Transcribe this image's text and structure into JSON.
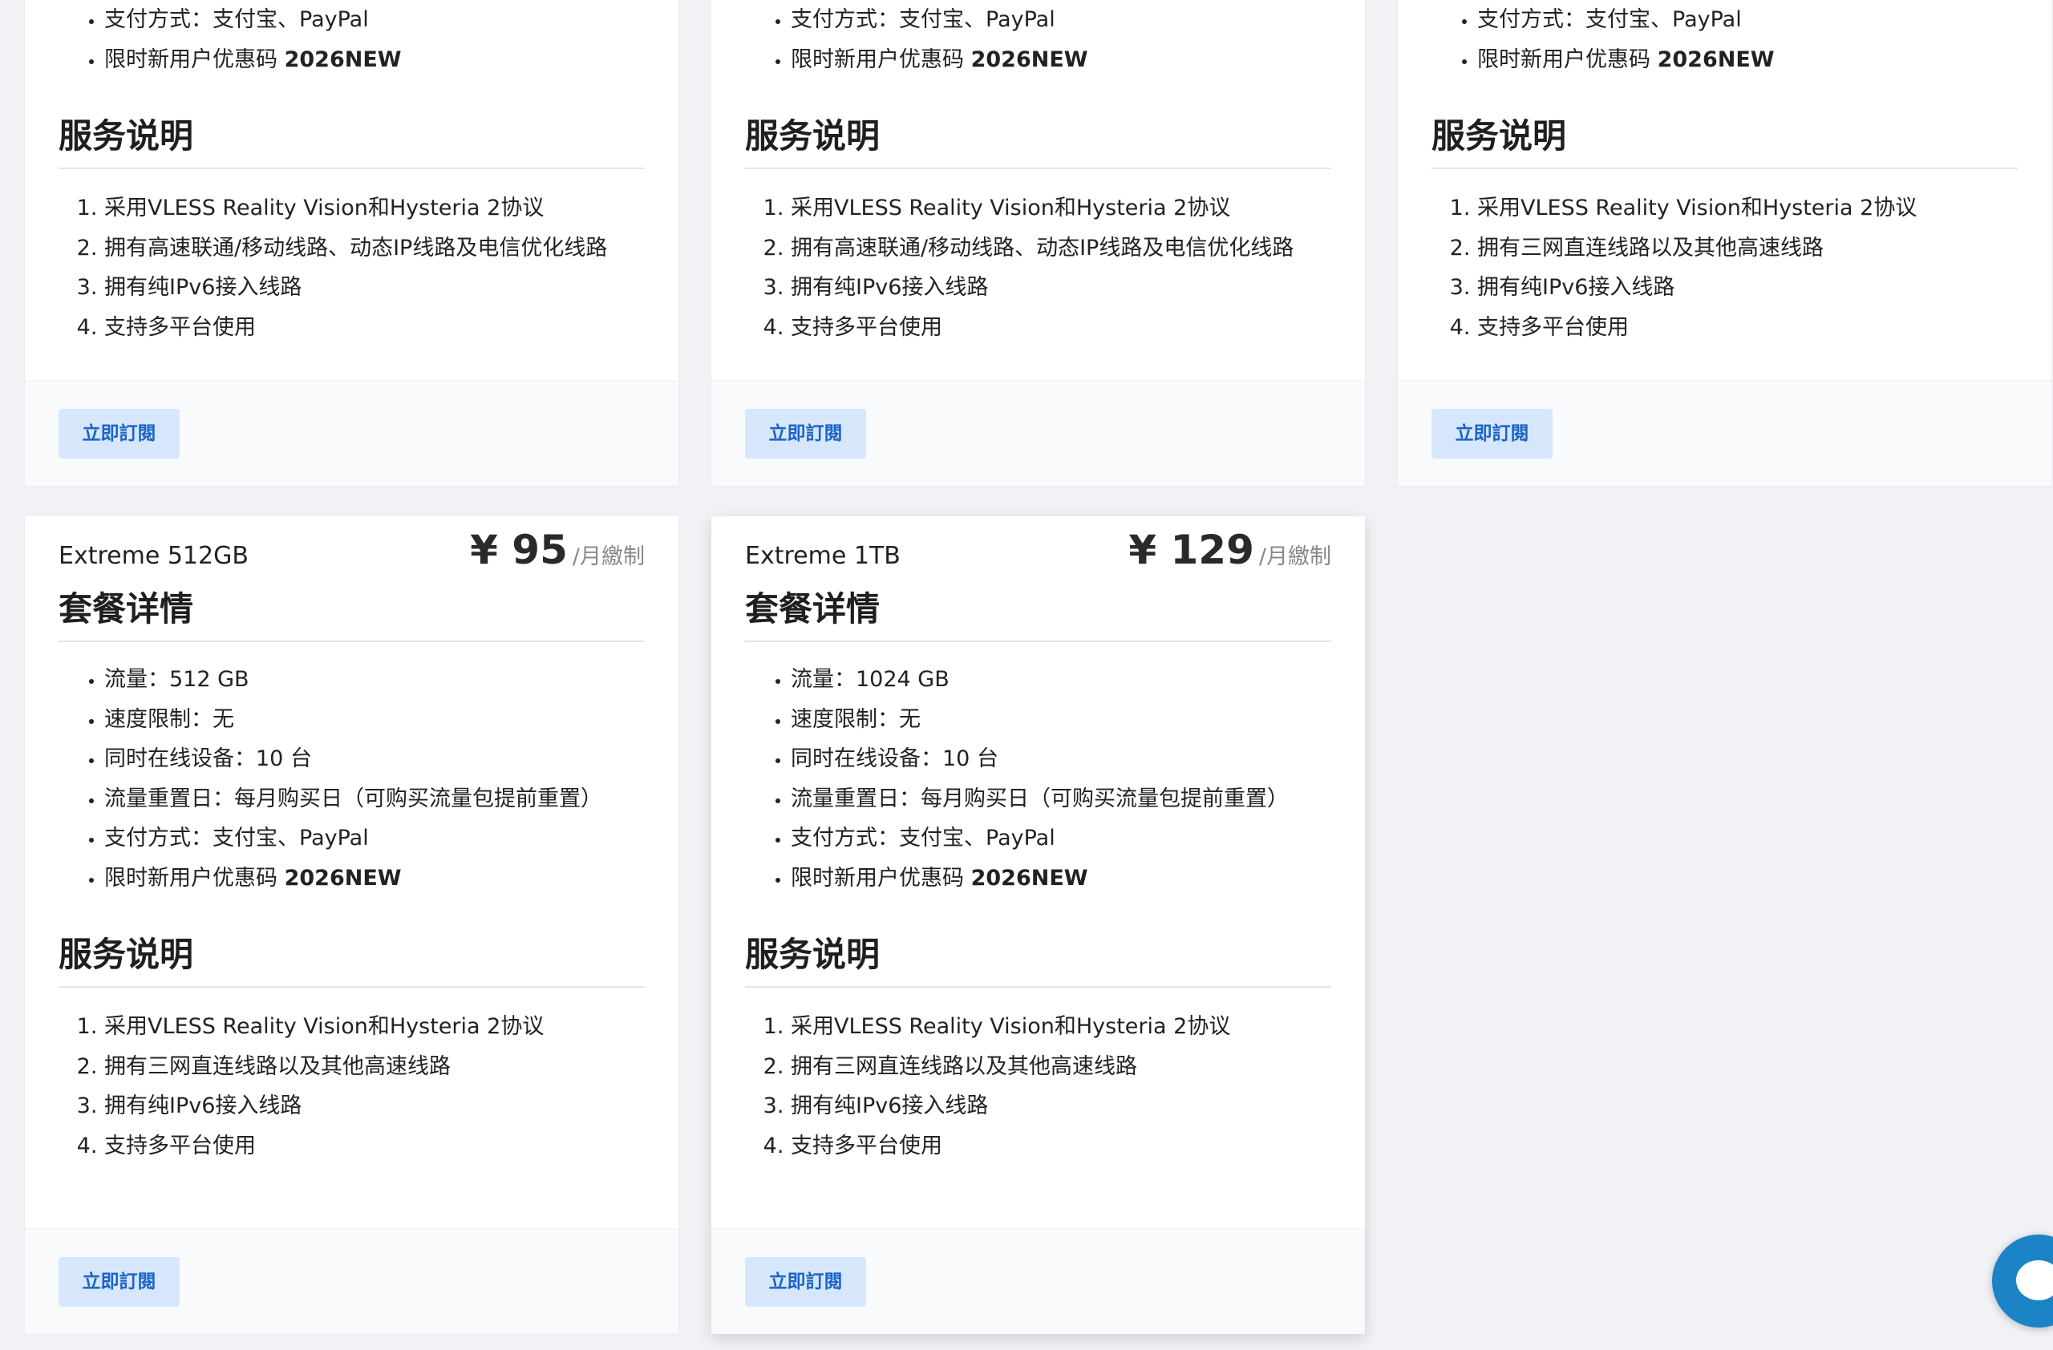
{
  "top_cards": [
    {
      "detail_tail": [
        {
          "text": "支付方式：支付宝、PayPal",
          "bold": ""
        },
        {
          "text": "限时新用户优惠码 ",
          "bold": "2026NEW"
        }
      ],
      "service_title": "服务说明",
      "service_items": [
        "采用VLESS Reality Vision和Hysteria 2协议",
        "拥有高速联通/移动线路、动态IP线路及电信优化线路",
        "拥有纯IPv6接入线路",
        "支持多平台使用"
      ],
      "button_label": "立即訂閱"
    },
    {
      "detail_tail": [
        {
          "text": "支付方式：支付宝、PayPal",
          "bold": ""
        },
        {
          "text": "限时新用户优惠码 ",
          "bold": "2026NEW"
        }
      ],
      "service_title": "服务说明",
      "service_items": [
        "采用VLESS Reality Vision和Hysteria 2协议",
        "拥有高速联通/移动线路、动态IP线路及电信优化线路",
        "拥有纯IPv6接入线路",
        "支持多平台使用"
      ],
      "button_label": "立即訂閱"
    },
    {
      "detail_tail": [
        {
          "text": "支付方式：支付宝、PayPal",
          "bold": ""
        },
        {
          "text": "限时新用户优惠码 ",
          "bold": "2026NEW"
        }
      ],
      "service_title": "服务说明",
      "service_items": [
        "采用VLESS Reality Vision和Hysteria 2协议",
        "拥有三网直连线路以及其他高速线路",
        "拥有纯IPv6接入线路",
        "支持多平台使用"
      ],
      "button_label": "立即訂閱"
    }
  ],
  "bottom_cards": [
    {
      "plan_name": "Extreme 512GB",
      "price_amount": "¥ 95",
      "price_unit": "/月繳制",
      "detail_title": "套餐详情",
      "detail_items": [
        {
          "text": "流量：512 GB",
          "bold": ""
        },
        {
          "text": "速度限制：无",
          "bold": ""
        },
        {
          "text": "同时在线设备：10 台",
          "bold": ""
        },
        {
          "text": "流量重置日：每月购买日（可购买流量包提前重置）",
          "bold": ""
        },
        {
          "text": "支付方式：支付宝、PayPal",
          "bold": ""
        },
        {
          "text": "限时新用户优惠码 ",
          "bold": "2026NEW"
        }
      ],
      "service_title": "服务说明",
      "service_items": [
        "采用VLESS Reality Vision和Hysteria 2协议",
        "拥有三网直连线路以及其他高速线路",
        "拥有纯IPv6接入线路",
        "支持多平台使用"
      ],
      "button_label": "立即訂閱"
    },
    {
      "plan_name": "Extreme 1TB",
      "price_amount": "¥ 129",
      "price_unit": "/月繳制",
      "detail_title": "套餐详情",
      "detail_items": [
        {
          "text": "流量：1024 GB",
          "bold": ""
        },
        {
          "text": "速度限制：无",
          "bold": ""
        },
        {
          "text": "同时在线设备：10 台",
          "bold": ""
        },
        {
          "text": "流量重置日：每月购买日（可购买流量包提前重置）",
          "bold": ""
        },
        {
          "text": "支付方式：支付宝、PayPal",
          "bold": ""
        },
        {
          "text": "限时新用户优惠码 ",
          "bold": "2026NEW"
        }
      ],
      "service_title": "服务说明",
      "service_items": [
        "采用VLESS Reality Vision和Hysteria 2协议",
        "拥有三网直连线路以及其他高速线路",
        "拥有纯IPv6接入线路",
        "支持多平台使用"
      ],
      "button_label": "立即訂閱"
    }
  ],
  "icons": {
    "chat": "chat-bubble-icon"
  },
  "colors": {
    "accent": "#1a64c8",
    "button_bg": "#d6e6fb",
    "chat": "#1b84c6"
  }
}
